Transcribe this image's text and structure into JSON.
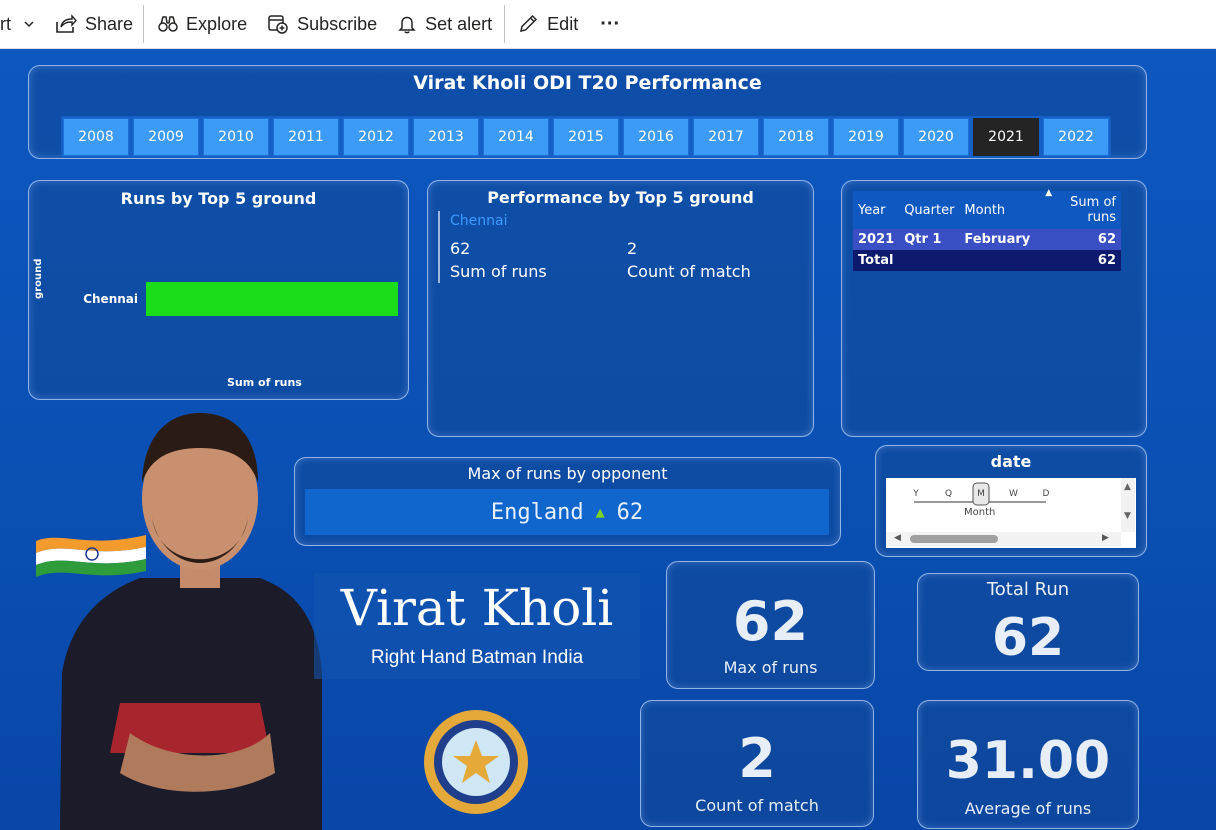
{
  "toolbar": {
    "partial": "rt",
    "share": "Share",
    "explore": "Explore",
    "subscribe": "Subscribe",
    "set_alert": "Set alert",
    "edit": "Edit",
    "more": "···"
  },
  "header": {
    "title": "Virat Kholi ODI T20 Performance",
    "years": [
      "2008",
      "2009",
      "2010",
      "2011",
      "2012",
      "2013",
      "2014",
      "2015",
      "2016",
      "2017",
      "2018",
      "2019",
      "2020",
      "2021",
      "2022"
    ],
    "selected_year": "2021"
  },
  "runs_by_ground": {
    "title": "Runs by Top 5 ground",
    "ylabel": "ground",
    "xlabel": "Sum of runs",
    "bar_color": "#1bdc1b"
  },
  "chart_data": {
    "type": "bar",
    "orientation": "horizontal",
    "categories": [
      "Chennai"
    ],
    "values": [
      62
    ],
    "title": "Runs by Top 5 ground",
    "xlabel": "Sum of runs",
    "ylabel": "ground"
  },
  "perf_by_ground": {
    "title": "Performance by Top 5 ground",
    "ground": "Chennai",
    "runs_value": "62",
    "runs_label": "Sum of runs",
    "count_value": "2",
    "count_label": "Count of match"
  },
  "matrix": {
    "headers": [
      "Year",
      "Quarter",
      "Month",
      "Sum of runs"
    ],
    "row": [
      "2021",
      "Qtr 1",
      "February",
      "62"
    ],
    "total_label": "Total",
    "total_value": "62"
  },
  "max_opponent": {
    "title": "Max of runs by opponent",
    "opponent": "England",
    "value": "62"
  },
  "date_slicer": {
    "title": "date",
    "levels": [
      "Y",
      "Q",
      "M",
      "W",
      "D"
    ],
    "selected_level": "M",
    "label": "Month"
  },
  "profile": {
    "name": "Virat Kholi",
    "subtitle": "Right Hand Batman India"
  },
  "kpis": {
    "max_runs_value": "62",
    "max_runs_label": "Max of runs",
    "total_run_title": "Total Run",
    "total_run_value": "62",
    "count_match_value": "2",
    "count_match_label": "Count of match",
    "avg_runs_value": "31.00",
    "avg_runs_label": "Average of runs"
  }
}
